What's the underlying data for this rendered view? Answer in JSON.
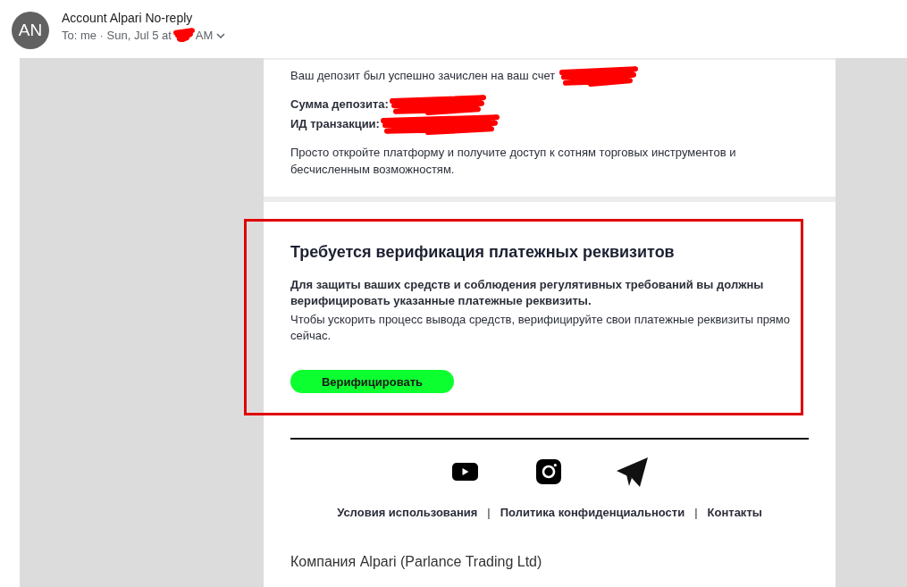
{
  "sender": {
    "initials": "AN",
    "name": "Account Alpari No-reply",
    "recipient_line": "To: me · Sun, Jul 5 at",
    "time_redacted": true,
    "time_suffix": "AM"
  },
  "deposit": {
    "message": "Ваш депозит был успешно зачислен на ваш счет",
    "account_redacted": true,
    "fields": [
      {
        "label": "Сумма депозита:",
        "redacted": true
      },
      {
        "label": "ИД транзакции:",
        "redacted": true
      }
    ],
    "note": "Просто откройте платформу и получите доступ к сотням торговых инструментов и бесчисленным возможностям."
  },
  "verification": {
    "highlighted": true,
    "title": "Требуется верификация платежных реквизитов",
    "warning": "Для защиты ваших средств и соблюдения регулятивных требований вы должны верифицировать указанные платежные реквизиты.",
    "text": "Чтобы ускорить процесс вывода средств, верифицируйте свои платежные реквизиты прямо сейчас.",
    "button": "Верифицировать"
  },
  "footer": {
    "links": [
      "Условия использования",
      "Политика конфиденциальности",
      "Контакты"
    ],
    "separator": "|",
    "company": "Компания Alpari (Parlance Trading Ltd)"
  }
}
